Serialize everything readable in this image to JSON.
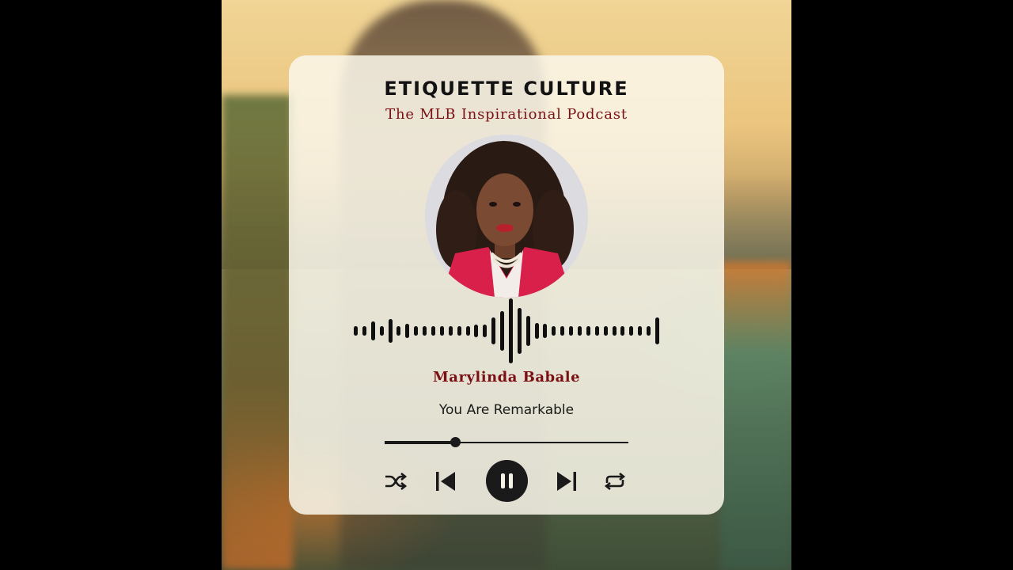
{
  "background": {
    "frame_color": "#000000",
    "scene": "sunset-field-woman"
  },
  "player": {
    "title": "ETIQUETTE CULTURE",
    "subtitle": "The MLB Inspirational Podcast",
    "host_name": "Marylinda Babale",
    "episode_title": "You Are Remarkable",
    "progress": 0.29,
    "accent_color": "#7a1014",
    "card_color": "#faf7ea",
    "controls": {
      "shuffle_icon": "shuffle-icon",
      "previous_icon": "skip-previous-icon",
      "pause_icon": "pause-icon",
      "next_icon": "skip-next-icon",
      "repeat_icon": "repeat-icon"
    }
  },
  "waveform": {
    "levels": [
      0.14,
      0.14,
      0.26,
      0.14,
      0.32,
      0.14,
      0.2,
      0.14,
      0.14,
      0.14,
      0.14,
      0.14,
      0.14,
      0.14,
      0.18,
      0.18,
      0.38,
      0.55,
      0.9,
      0.62,
      0.42,
      0.22,
      0.2,
      0.14,
      0.14,
      0.14,
      0.14,
      0.14,
      0.14,
      0.14,
      0.14,
      0.14,
      0.14,
      0.14,
      0.14,
      0.36
    ]
  }
}
